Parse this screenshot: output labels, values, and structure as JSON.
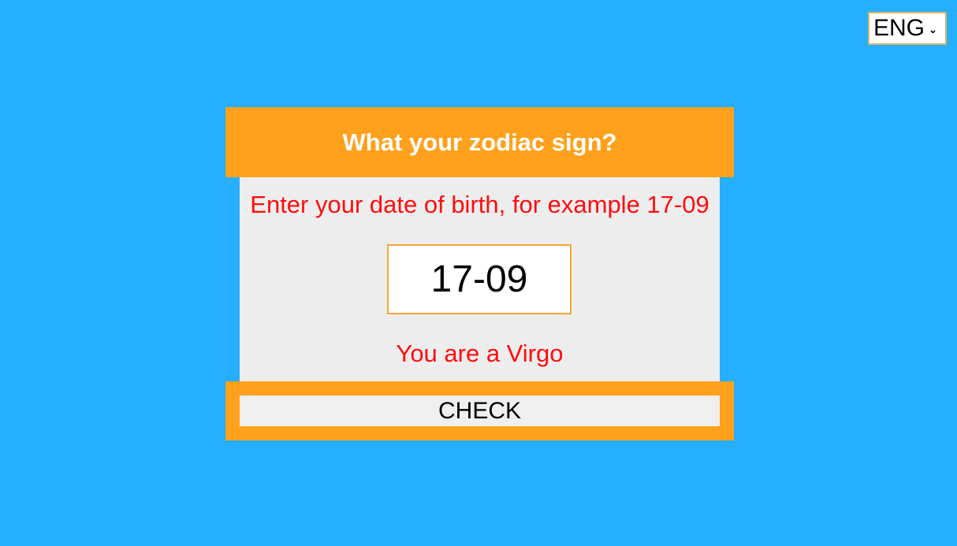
{
  "language": {
    "selected": "ENG",
    "icon": "chevron-down-icon"
  },
  "card": {
    "title": "What your zodiac sign?",
    "instruction": "Enter your date of birth, for example 17-09",
    "date_input": {
      "value": "17-09"
    },
    "result": "You are a Virgo",
    "check_label": "CHECK"
  },
  "colors": {
    "background": "#26aeff",
    "accent": "#ffa11c",
    "body": "#eeeded",
    "text_alert": "#ff0d0d"
  }
}
